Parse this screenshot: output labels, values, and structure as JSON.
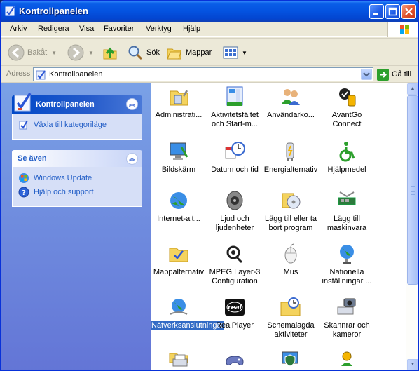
{
  "window": {
    "title": "Kontrollpanelen"
  },
  "menu": [
    "Arkiv",
    "Redigera",
    "Visa",
    "Favoriter",
    "Verktyg",
    "Hjälp"
  ],
  "toolbar": {
    "back": "Bakåt",
    "search": "Sök",
    "folders": "Mappar"
  },
  "address": {
    "label": "Adress",
    "value": "Kontrollpanelen",
    "go": "Gå till"
  },
  "left": {
    "panel1": {
      "title": "Kontrollpanelen",
      "link": "Växla till kategoriläge"
    },
    "panel2": {
      "title": "Se även",
      "links": [
        "Windows Update",
        "Hjälp och support"
      ]
    }
  },
  "items": [
    "Administrati...",
    "Aktivitetsfältet och Start-m...",
    "Användarko...",
    "AvantGo Connect",
    "Bildskärm",
    "Datum och tid",
    "Energialternativ",
    "Hjälpmedel",
    "Internet-alt...",
    "Ljud och ljudenheter",
    "Lägg till eller ta bort program",
    "Lägg till maskinvara",
    "Mappalternativ",
    "MPEG Layer-3 Configuration",
    "Mus",
    "Nationella inställningar ...",
    "Nätverksanslutningar",
    "RealPlayer",
    "Schemalagda aktiviteter",
    "Skannrar och kameror"
  ]
}
